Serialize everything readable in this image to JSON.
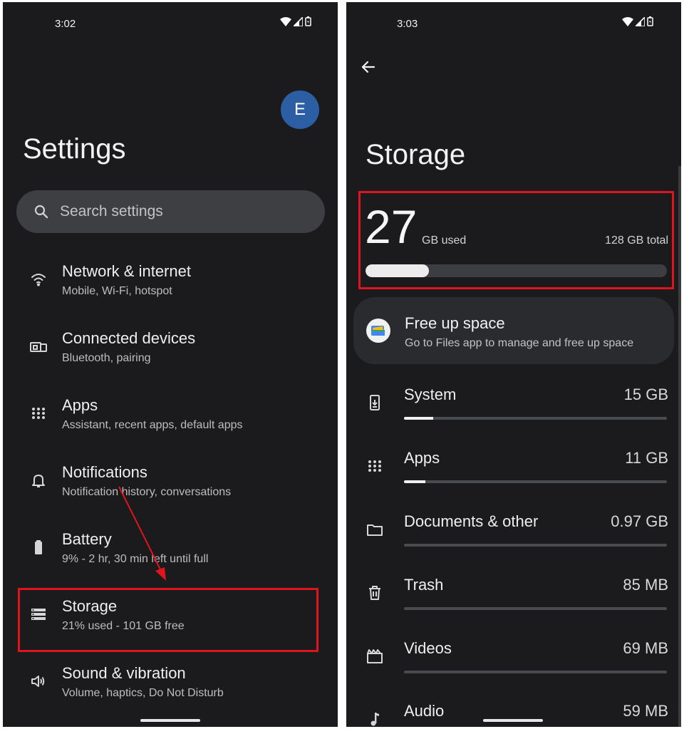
{
  "left": {
    "status_time": "3:02",
    "avatar_letter": "E",
    "title": "Settings",
    "search_placeholder": "Search settings",
    "items": [
      {
        "title": "Network & internet",
        "subtitle": "Mobile, Wi-Fi, hotspot",
        "icon": "wifi-icon"
      },
      {
        "title": "Connected devices",
        "subtitle": "Bluetooth, pairing",
        "icon": "devices-icon"
      },
      {
        "title": "Apps",
        "subtitle": "Assistant, recent apps, default apps",
        "icon": "apps-grid-icon"
      },
      {
        "title": "Notifications",
        "subtitle": "Notification history, conversations",
        "icon": "bell-icon"
      },
      {
        "title": "Battery",
        "subtitle": "9% - 2 hr, 30 min left until full",
        "icon": "battery-icon"
      },
      {
        "title": "Storage",
        "subtitle": "21% used - 101 GB free",
        "icon": "storage-icon"
      },
      {
        "title": "Sound & vibration",
        "subtitle": "Volume, haptics, Do Not Disturb",
        "icon": "speaker-icon"
      }
    ]
  },
  "right": {
    "status_time": "3:03",
    "title": "Storage",
    "used_number": "27",
    "used_unit": "GB used",
    "total": "128 GB total",
    "used_fraction": 0.21,
    "free_up": {
      "title": "Free up space",
      "subtitle": "Go to Files app to manage and free up space"
    },
    "categories": [
      {
        "name": "System",
        "size": "15 GB",
        "fraction": 0.11,
        "icon": "system-update-icon"
      },
      {
        "name": "Apps",
        "size": "11 GB",
        "fraction": 0.08,
        "icon": "apps-grid-icon"
      },
      {
        "name": "Documents & other",
        "size": "0.97 GB",
        "fraction": 0.0,
        "icon": "folder-icon"
      },
      {
        "name": "Trash",
        "size": "85 MB",
        "fraction": 0.0,
        "icon": "trash-icon"
      },
      {
        "name": "Videos",
        "size": "69 MB",
        "fraction": 0.0,
        "icon": "video-icon"
      },
      {
        "name": "Audio",
        "size": "59 MB",
        "fraction": 0.0,
        "icon": "music-note-icon"
      }
    ]
  },
  "colors": {
    "highlight": "#e0141c",
    "avatar": "#2c5ea3",
    "background": "#1b1b1d"
  }
}
